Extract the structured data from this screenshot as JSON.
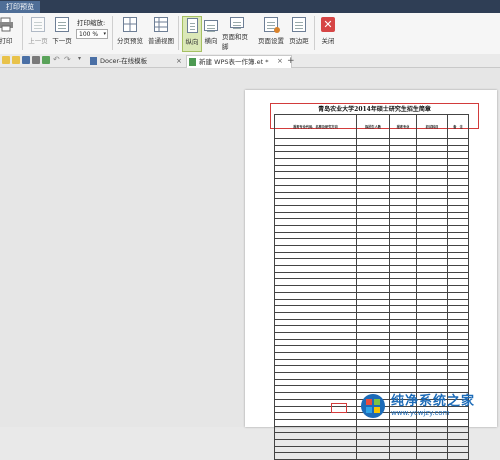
{
  "window": {
    "title": "打印预览"
  },
  "ribbon": {
    "print": "打印",
    "prev_page": "上一页",
    "next_page": "下一页",
    "zoom_label": "打印缩放:",
    "zoom_value": "100 %",
    "page_preview": "分页预览",
    "normal_view": "普通视图",
    "portrait": "纵向",
    "landscape": "横向",
    "header_footer": "页面和页脚",
    "page_setup": "页面设置",
    "margins": "页边距",
    "close": "关闭"
  },
  "tabs": [
    {
      "label": "Docer-在线模板"
    },
    {
      "label": "新建 WPS表一作簿.et *"
    }
  ],
  "document": {
    "title": "青岛农业大学2014年硕士研究生招生简章",
    "columns": [
      "报考专业代码、名称及研究方向",
      "拟招生人数",
      "报考专业",
      "初试科目",
      "备　注"
    ]
  },
  "watermark": {
    "name": "纯净系统之家",
    "url": "www.ycwjzy.com"
  },
  "colors": {
    "accent": "#d23b3b",
    "titlebar": "#2f3e55",
    "watermark": "#1c6bb8"
  }
}
